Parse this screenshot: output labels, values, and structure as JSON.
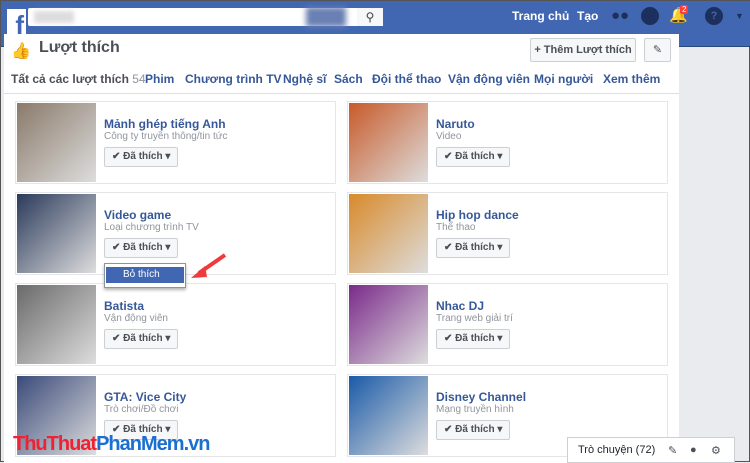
{
  "header": {
    "search_placeholder": "",
    "home": "Trang chủ",
    "create": "Tạo",
    "notification_count": "2",
    "brand_color": "#4267b2"
  },
  "page": {
    "title": "Lượt thích",
    "add_button": "+ Thêm Lượt thích"
  },
  "tabs": [
    {
      "label": "Tất cả các lượt thích",
      "count": "54"
    },
    {
      "label": "Phim"
    },
    {
      "label": "Chương trình TV"
    },
    {
      "label": "Nghệ sĩ"
    },
    {
      "label": "Sách"
    },
    {
      "label": "Đội thể thao"
    },
    {
      "label": "Vận động viên"
    },
    {
      "label": "Mọi người"
    },
    {
      "label": "Xem thêm"
    }
  ],
  "liked_label": "✔ Đã thích ▾",
  "cards": [
    {
      "name": "Mảnh ghép tiếng Anh",
      "category": "Công ty truyền thông/tin tức",
      "color": "#8a7a6a"
    },
    {
      "name": "Naruto",
      "category": "Video",
      "color": "#c85a2a"
    },
    {
      "name": "Video game",
      "category": "Loại chương trình TV",
      "color": "#2a3a5a"
    },
    {
      "name": "Hip hop dance",
      "category": "Thể thao",
      "color": "#d88a2a"
    },
    {
      "name": "Batista",
      "category": "Vận động viên",
      "color": "#6a6a6a"
    },
    {
      "name": "Nhac DJ",
      "category": "Trang web giải trí",
      "color": "#7a2a8a"
    },
    {
      "name": "GTA: Vice City",
      "category": "Trò chơi/Đồ chơi",
      "color": "#3a4a7a"
    },
    {
      "name": "Disney Channel",
      "category": "Mạng truyền hình",
      "color": "#1a5aa8"
    }
  ],
  "dropdown": {
    "unlike": "Bỏ thích"
  },
  "chat": {
    "label": "Trò chuyện (72)"
  },
  "watermark": {
    "part1": "ThuThuat",
    "part2": "PhanMem",
    "part3": ".vn"
  }
}
